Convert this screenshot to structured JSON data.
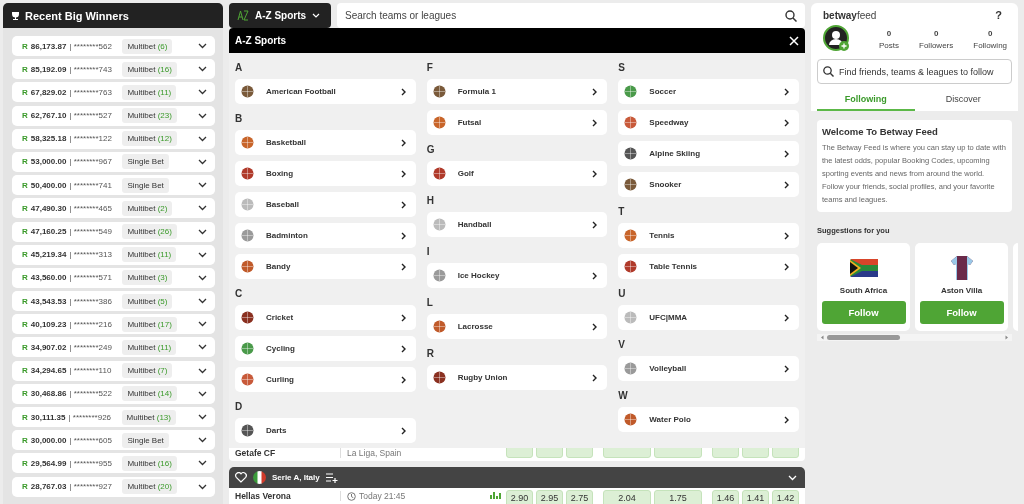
{
  "winners_panel": {
    "title": "Recent Big Winners",
    "rows": [
      {
        "currency": "R",
        "amount": "86,173.87",
        "account": "| ********562",
        "bet_type": "Multibet",
        "legs": "(6)"
      },
      {
        "currency": "R",
        "amount": "85,192.09",
        "account": "| ********743",
        "bet_type": "Multibet",
        "legs": "(16)"
      },
      {
        "currency": "R",
        "amount": "67,829.02",
        "account": "| ********763",
        "bet_type": "Multibet",
        "legs": "(11)"
      },
      {
        "currency": "R",
        "amount": "62,767.10",
        "account": "| ********527",
        "bet_type": "Multibet",
        "legs": "(23)"
      },
      {
        "currency": "R",
        "amount": "58,325.18",
        "account": "| ********122",
        "bet_type": "Multibet",
        "legs": "(12)"
      },
      {
        "currency": "R",
        "amount": "53,000.00",
        "account": "| ********967",
        "bet_type": "Single Bet"
      },
      {
        "currency": "R",
        "amount": "50,400.00",
        "account": "| ********741",
        "bet_type": "Single Bet"
      },
      {
        "currency": "R",
        "amount": "47,490.30",
        "account": "| ********465",
        "bet_type": "Multibet",
        "legs": "(2)"
      },
      {
        "currency": "R",
        "amount": "47,160.25",
        "account": "| ********549",
        "bet_type": "Multibet",
        "legs": "(26)"
      },
      {
        "currency": "R",
        "amount": "45,219.34",
        "account": "| ********313",
        "bet_type": "Multibet",
        "legs": "(11)"
      },
      {
        "currency": "R",
        "amount": "43,560.00",
        "account": "| ********571",
        "bet_type": "Multibet",
        "legs": "(3)"
      },
      {
        "currency": "R",
        "amount": "43,543.53",
        "account": "| ********386",
        "bet_type": "Multibet",
        "legs": "(5)"
      },
      {
        "currency": "R",
        "amount": "40,109.23",
        "account": "| ********216",
        "bet_type": "Multibet",
        "legs": "(17)"
      },
      {
        "currency": "R",
        "amount": "34,907.02",
        "account": "| ********249",
        "bet_type": "Multibet",
        "legs": "(11)"
      },
      {
        "currency": "R",
        "amount": "34,294.65",
        "account": "| ********110",
        "bet_type": "Multibet",
        "legs": "(7)"
      },
      {
        "currency": "R",
        "amount": "30,468.86",
        "account": "| ********522",
        "bet_type": "Multibet",
        "legs": "(14)"
      },
      {
        "currency": "R",
        "amount": "30,111.35",
        "account": "| ********926",
        "bet_type": "Multibet",
        "legs": "(13)"
      },
      {
        "currency": "R",
        "amount": "30,000.00",
        "account": "| ********605",
        "bet_type": "Single Bet"
      },
      {
        "currency": "R",
        "amount": "29,564.99",
        "account": "| ********955",
        "bet_type": "Multibet",
        "legs": "(16)"
      },
      {
        "currency": "R",
        "amount": "28,767.03",
        "account": "| ********927",
        "bet_type": "Multibet",
        "legs": "(20)"
      }
    ]
  },
  "sports_menu": {
    "label": "A-Z Sports",
    "expanded": true
  },
  "search": {
    "placeholder": "Search teams or leagues"
  },
  "az_overlay": {
    "title": "A-Z Sports",
    "columns": [
      [
        {
          "letter": "A",
          "sports": [
            "American Football"
          ]
        },
        {
          "letter": "B",
          "sports": [
            "Basketball",
            "Boxing",
            "Baseball",
            "Badminton",
            "Bandy"
          ]
        },
        {
          "letter": "C",
          "sports": [
            "Cricket",
            "Cycling",
            "Curling"
          ]
        },
        {
          "letter": "D",
          "sports": [
            "Darts"
          ]
        }
      ],
      [
        {
          "letter": "F",
          "sports": [
            "Formula 1",
            "Futsal"
          ]
        },
        {
          "letter": "G",
          "sports": [
            "Golf"
          ]
        },
        {
          "letter": "H",
          "sports": [
            "Handball"
          ]
        },
        {
          "letter": "I",
          "sports": [
            "Ice Hockey"
          ]
        },
        {
          "letter": "L",
          "sports": [
            "Lacrosse"
          ]
        },
        {
          "letter": "R",
          "sports": [
            "Rugby Union"
          ]
        }
      ],
      [
        {
          "letter": "S",
          "sports": [
            "Soccer",
            "Speedway",
            "Alpine Skiing",
            "Snooker"
          ]
        },
        {
          "letter": "T",
          "sports": [
            "Tennis",
            "Table Tennis"
          ]
        },
        {
          "letter": "U",
          "sports": [
            "UFC|MMA"
          ]
        },
        {
          "letter": "V",
          "sports": [
            "Volleyball"
          ]
        },
        {
          "letter": "W",
          "sports": [
            "Water Polo"
          ]
        }
      ]
    ]
  },
  "matches": [
    {
      "kind": "match",
      "team": "Getafe CF",
      "info": "La Liga, Spain"
    },
    {
      "kind": "league",
      "title": "Serie A, Italy"
    },
    {
      "kind": "match",
      "team": "Hellas Verona",
      "info": "Today 21:45",
      "odds": [
        "2.90",
        "2.95",
        "2.75",
        "2.04",
        "1.75",
        "1.46",
        "1.41",
        "1.42"
      ]
    }
  ],
  "feed": {
    "logo_bold": "betway",
    "logo_light": "feed",
    "help": "?",
    "stats": [
      {
        "value": "0",
        "label": "Posts"
      },
      {
        "value": "0",
        "label": "Followers"
      },
      {
        "value": "0",
        "label": "Following"
      }
    ],
    "search": {
      "placeholder": "Find friends, teams & leagues to follow"
    },
    "tabs": [
      {
        "label": "Following",
        "selected": true
      },
      {
        "label": "Discover",
        "selected": false
      }
    ],
    "welcome": {
      "title": "Welcome To Betway Feed",
      "text": "The Betway Feed is where you can stay up to date with the latest odds, popular Booking Codes, upcoming sporting events and news from around the world. Follow your friends, social profiles, and your favorite teams and leagues."
    },
    "suggestions_title": "Suggestions for you",
    "suggestions": [
      {
        "kind": "flag",
        "name": "South Africa",
        "button": "Follow"
      },
      {
        "kind": "shirt",
        "name": "Aston Villa",
        "button": "Follow"
      }
    ]
  }
}
